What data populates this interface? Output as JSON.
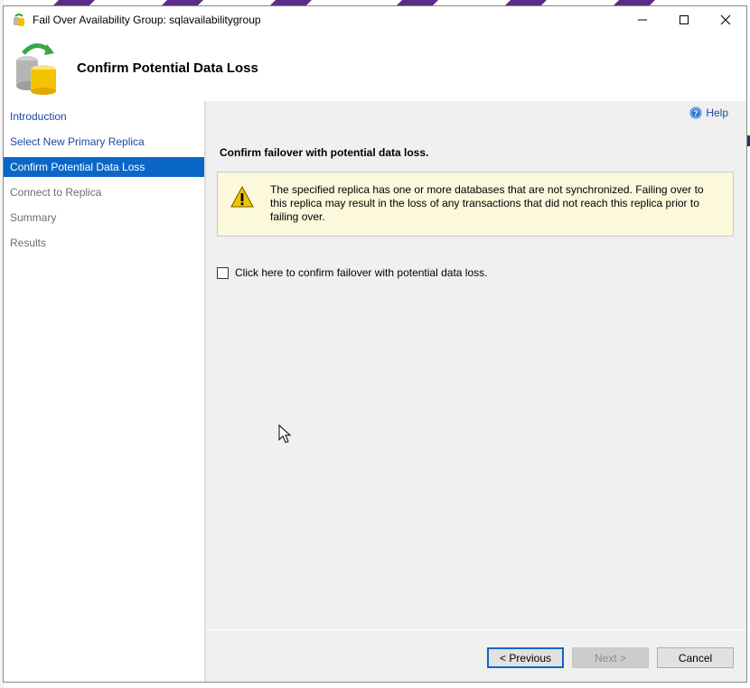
{
  "window": {
    "title": "Fail Over Availability Group: sqlavailabilitygroup",
    "minimize": "minimize",
    "maximize": "maximize",
    "close": "close"
  },
  "header": {
    "title": "Confirm Potential Data Loss",
    "icon": "database-failover-icon"
  },
  "sidebar": {
    "items": [
      {
        "label": "Introduction",
        "state": "done"
      },
      {
        "label": "Select New Primary Replica",
        "state": "done"
      },
      {
        "label": "Confirm Potential Data Loss",
        "state": "active"
      },
      {
        "label": "Connect to Replica",
        "state": "pending"
      },
      {
        "label": "Summary",
        "state": "pending"
      },
      {
        "label": "Results",
        "state": "pending"
      }
    ]
  },
  "content": {
    "help_label": "Help",
    "section_title": "Confirm failover with potential data loss.",
    "warning_text": "The specified replica has one or more databases that are not synchronized. Failing over to this replica may result in the loss of any transactions that did not reach this replica prior to failing over.",
    "confirm_label": "Click here to confirm failover with potential data loss.",
    "confirm_checked": false
  },
  "footer": {
    "previous_label": "< Previous",
    "next_label": "Next >",
    "cancel_label": "Cancel"
  },
  "colors": {
    "accent": "#0b67c7",
    "link": "#1c4aa0",
    "warning_bg": "#fbf8dc"
  }
}
